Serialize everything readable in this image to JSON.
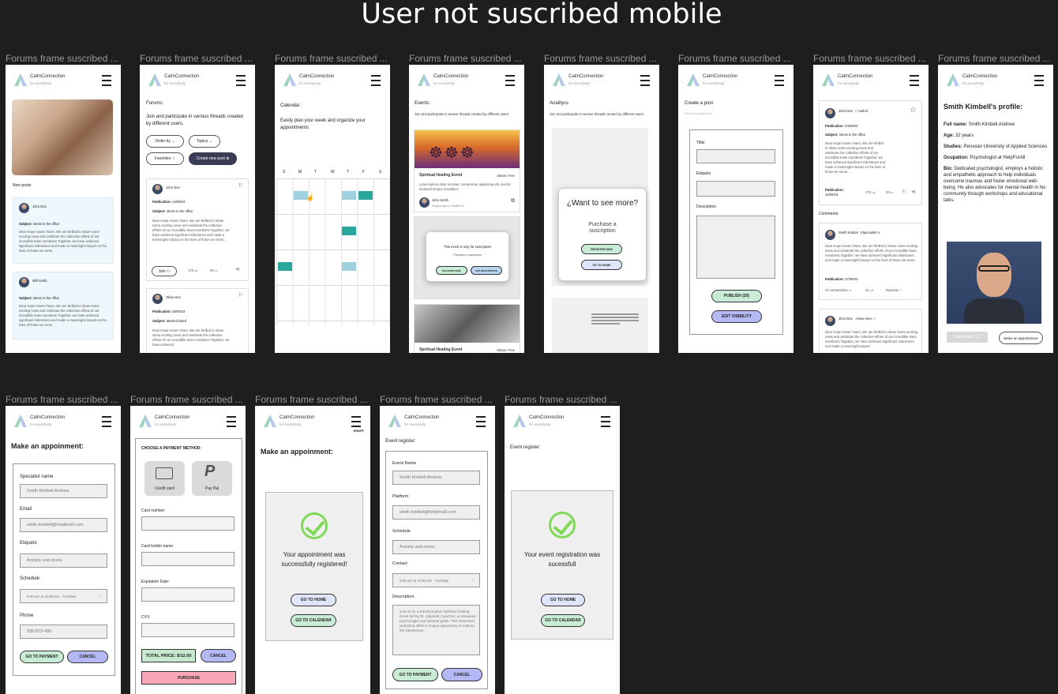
{
  "page": {
    "title": "User not suscribed mobile"
  },
  "frame_label": "Forums frame suscribed ...",
  "brand": {
    "name": "CalmConnection",
    "tagline": "for everybody"
  },
  "home": {
    "new_posts": "New posts",
    "posts": [
      {
        "author": "John Doe",
        "subject_label": "Subject:",
        "subject": "stress in the office",
        "body": "Dear Hope Haven Team, We are thrilled to share some exciting news and celebrate the collective efforts of our incredible team members! Together, we have achieved significant milestones and made a meaningful impact on the lives of those we serve."
      },
      {
        "author": "Will Smith",
        "subject_label": "Subject:",
        "subject": "stress in the office",
        "body": "Dear Hope Haven Team, We are thrilled to share some exciting news and celebrate the collective efforts of our incredible team members! Together, we have achieved significant milestones and made a meaningful impact on the lives of those we serve."
      }
    ]
  },
  "forums": {
    "title": "Forums:",
    "intro": "Join and participate in various threads created by different users.",
    "order_by": "Order by",
    "topics": "Topics",
    "favorites": "Favorites",
    "create_post": "Create new post",
    "posts": [
      {
        "author": "John Doe",
        "publication_label": "Publication:",
        "publication": "24/09/23",
        "subject_label": "Subject:",
        "subject": "stress in the office",
        "body": "Dear Hope Haven Team, We are thrilled to share some exciting news and celebrate the collective efforts of our incredible team members! Together, we have achieved significant milestones and made a meaningful impact on the lives of those we serve...",
        "join": "Join",
        "likes": "170",
        "comments": "29"
      },
      {
        "author": "Olivia Kim",
        "publication_label": "Publication:",
        "publication": "28/09/23",
        "subject_label": "Subject:",
        "subject": "Married failed",
        "body": "Dear Hope Haven Team, We are thrilled to share some exciting news and celebrate the collective efforts of our incredible team members! Together, we have achieved"
      }
    ]
  },
  "calendar": {
    "title": "Calendar:",
    "intro": "Easily plan your week and organize your appointments",
    "days": [
      "S",
      "M",
      "T",
      "W",
      "T",
      "F",
      "S"
    ]
  },
  "events": {
    "title": "Events:",
    "intro": "Join and participate in various threads created by different users.",
    "event_name": "Spiritual Healing Event",
    "status": "Status: Free",
    "desc": "Lorem ipsum dolor sit amet, consectetur adipiscing elit, sed do eiusmod tempor incididunt.",
    "host": "John Smith",
    "host_role": "Phsycologist in HealthFoo",
    "locked_msg": "This event is only for suscriptors",
    "locked_sub": "Purchase a suscription",
    "register_now": "REGISTER NOW",
    "get_description": "GET DESCRIPTION"
  },
  "analytics": {
    "title": "Analitycs",
    "intro": "Join and participate in various threads created by different users.",
    "modal_title": "¿Want to see more?",
    "modal_sub": "Purchase a suscription",
    "register_now": "REGISTER NOW",
    "go_home": "GO TO HOME"
  },
  "create_post": {
    "title": "Create a post",
    "sub": "No recent publications",
    "f_title": "Tittle",
    "f_tags": "Etiquets",
    "f_desc": "Description",
    "publish": "PUBLISH (20)",
    "edit_visibility": "EDIT VISIBILITY"
  },
  "post_detail": {
    "author": "John Doe",
    "author_tag": "Author",
    "publication_label": "Publication:",
    "publication": "24/09/23",
    "subject_label": "Subject:",
    "subject": "stress in the office",
    "body": "Dear Hope Haven Team, We are thrilled to share some exciting news and celebrate the collective efforts of our incredible team members! Together, we have achieved significant milestones and made a meaningful impact on the lives of those we serve...",
    "publication2_label": "Publication:",
    "publication2": "24/09/23",
    "likes": "170",
    "comments": "29",
    "comments_title": "Comments:",
    "c1_author": "Smith Kimbal",
    "c1_tag": "Especialist",
    "c1_body": "Dear Hope Haven Team, We are thrilled to share some exciting news and celebrate the collective efforts of our incredible team members! Together, we have achieved significant milestones and made a meaningful impact on the lives of those we serve.",
    "c1_pub_label": "Publication:",
    "c1_pub": "27/09/23",
    "c1_comments": "24 comentarios",
    "c1_likes": "54",
    "c1_report": "Reportar",
    "c2_author": "Jhon Doe",
    "c2_tag": "Active user",
    "c2_body": "Dear Hope Haven Team, We are thrilled to share some exciting news and celebrate the collective efforts of our incredible team members! Together, we have achieved significant milestones and made a meaningful impact"
  },
  "profile": {
    "title": "Smith Kimbell's profile:",
    "full_name_label": "Full name:",
    "full_name": "Smith Kimbell Andrew",
    "age_label": "Age:",
    "age": "32 years",
    "studies_label": "Studies:",
    "studies": "Peruvian University of Applied Sciences",
    "occupation_label": "Ocupation:",
    "occupation": "Psychologist at HelpForAll",
    "bio_label": "Bio:",
    "bio": "Dedicated psychologist, employs a holistic and empathetic approach to help individuals overcome traumas and foster emotional well-being. He also advocates for mental health in his community through workshops and educational talks.",
    "download_cv": "Download CV",
    "make_appointment": "Make an appointment"
  },
  "appointment": {
    "title": "Make an appoinment:",
    "specialist_label": "Specialist name",
    "specialist": "Smith Kimbell Andrew",
    "email_label": "Email",
    "email": "smith.kimbell@helpforall.com",
    "tags_label": "Etiquets",
    "tags": "Anxiety and stress",
    "schedule_label": "Schedule",
    "schedule": "9:00 am to 10:00 am - Tuesday",
    "phone_label": "Phone",
    "phone": "935-873-489",
    "go_payment": "GO TO PAYMENT",
    "cancel": "CANCEL"
  },
  "payment": {
    "title": "CHOOSE A PAYMENT METHOD:",
    "credit": "Credit card",
    "paypal": "Pay Pal",
    "card_number": "Card number:",
    "holder": "Card holder name:",
    "expiration": "Expiration Date:",
    "cvv": "CVV:",
    "total": "TOTAL PRICE: $/12.00",
    "cancel": "CANCEL",
    "purchase": "PURCHASE"
  },
  "appt_success": {
    "title": "Make an appoinment:",
    "corner": "ERDFF",
    "msg": "Your appointment was successfully registered!",
    "go_home": "GO TO HOME",
    "go_calendar": "GO TO CALENDAR"
  },
  "event_register": {
    "title": "Event register:",
    "name_label": "Event Name",
    "name": "Smith Kimbell Andrew",
    "platform_label": "Platform",
    "platform": "smith.kimbell@helpforall.com",
    "schedule_label": "Schedule",
    "schedule": "Anxiety and stress",
    "contact_label": "Contact",
    "contact": "9:00 am to 10:00 am - Tuesday",
    "desc_label": "Description",
    "desc": "Join us for a transformative Spiritual Healing Event led by Dr. Alejandro Sanchez, a renowned psychologist and spiritual guide. This immersive workshop offers a unique opportunity to explore the intersection",
    "go_payment": "GO TO PAYMENT",
    "cancel": "CANCEL"
  },
  "event_success": {
    "title": "Event register:",
    "msg": "Your event registration was sucessfull",
    "go_home": "GO TO HOME",
    "go_calendar": "GO TO CALENDAR"
  }
}
